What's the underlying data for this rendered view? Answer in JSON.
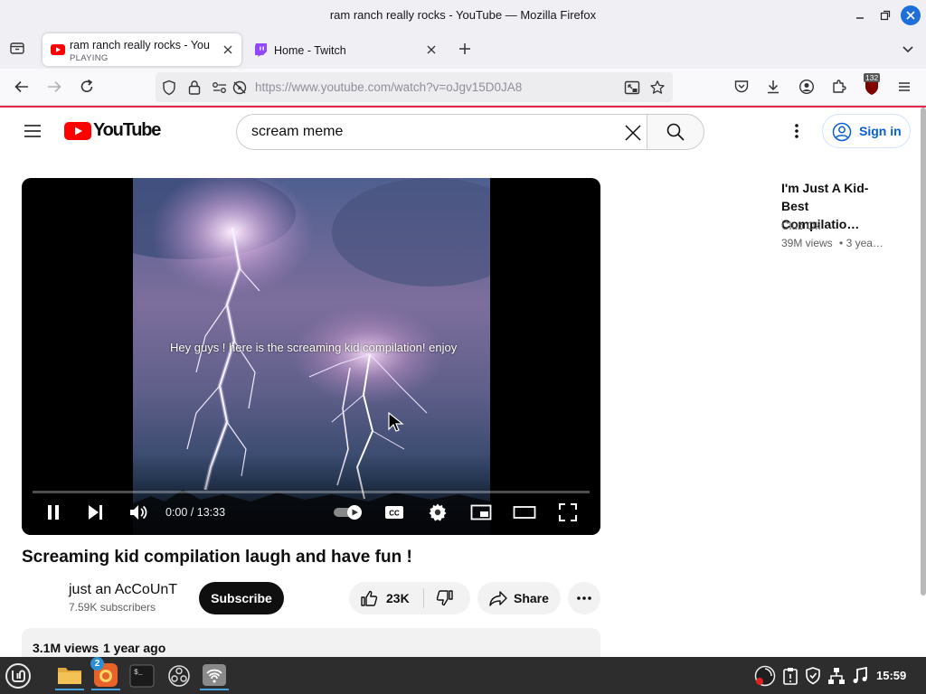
{
  "window": {
    "title": "ram ranch really rocks - YouTube — Mozilla Firefox"
  },
  "tabs": [
    {
      "label": "ram ranch really rocks - You",
      "sub": "PLAYING",
      "active": true
    },
    {
      "label": "Home - Twitch",
      "active": false
    }
  ],
  "navbar": {
    "url": "https://www.youtube.com/watch?v=oJgv15D0JA8",
    "extension_badge": "132"
  },
  "youtube": {
    "logo_text": "YouTube",
    "search": {
      "value": "scream meme"
    },
    "signin_label": "Sign in",
    "player": {
      "caption": "Hey guys ! here is the screaming kid compilation! enjoy",
      "time": "0:00 / 13:33",
      "progress": 0
    },
    "video": {
      "title": "Screaming kid compilation laugh and have fun !",
      "channel": "just an AcCoUnT",
      "subscribers": "7.59K subscribers",
      "subscribe_label": "Subscribe",
      "likes": "23K",
      "share_label": "Share",
      "views": "3.1M views",
      "age": "1 year ago"
    },
    "recommendation": {
      "title": "I'm Just A Kid- Best Compilatio…",
      "channel": "Club Ok",
      "views": "39M views",
      "age": "• 3 yea…"
    }
  },
  "taskbar": {
    "badge": "2",
    "clock": "15:59"
  },
  "colors": {
    "youtube_red": "#ff0000",
    "firefox_loading_line": "#e22850",
    "signin_blue": "#065fd4"
  }
}
